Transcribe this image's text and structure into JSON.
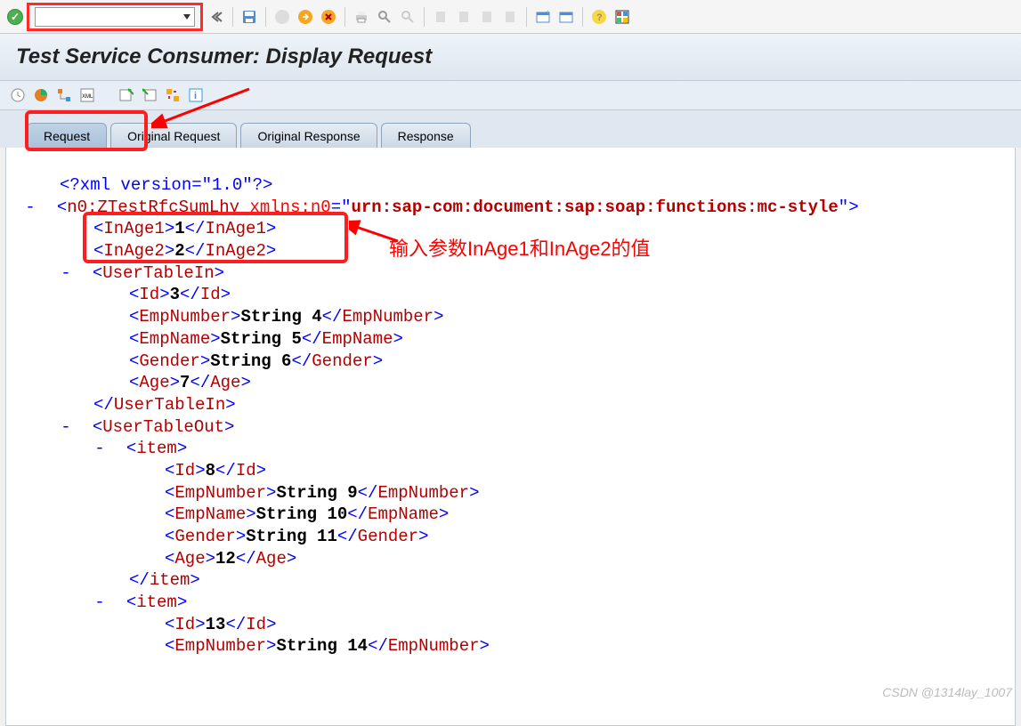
{
  "title": "Test Service Consumer: Display Request",
  "watermark": "CSDN @1314lay_1007",
  "tabs": {
    "request": "Request",
    "original_request": "Original Request",
    "original_response": "Original Response",
    "response": "Response"
  },
  "annotation_text": "输入参数InAge1和InAge2的值",
  "xml": {
    "decl": "<?xml version=\"1.0\"?>",
    "root_open": "n0:ZTestRfcSumLhy",
    "root_ns_attr": "xmlns:n0",
    "root_ns_val": "urn:sap-com:document:sap:soap:functions:mc-style",
    "inAge1_tag": "InAge1",
    "inAge1_val": "1",
    "inAge2_tag": "InAge2",
    "inAge2_val": "2",
    "userTableIn": "UserTableIn",
    "userTableOut": "UserTableOut",
    "item": "item",
    "id": "Id",
    "empNumber": "EmpNumber",
    "empName": "EmpName",
    "gender": "Gender",
    "age": "Age",
    "row1": {
      "id": "3",
      "empNumber": "String 4",
      "empName": "String 5",
      "gender": "String 6",
      "age": "7"
    },
    "row2": {
      "id": "8",
      "empNumber": "String 9",
      "empName": "String 10",
      "gender": "String 11",
      "age": "12"
    },
    "row3": {
      "id": "13",
      "empNumber": "String 14"
    }
  }
}
